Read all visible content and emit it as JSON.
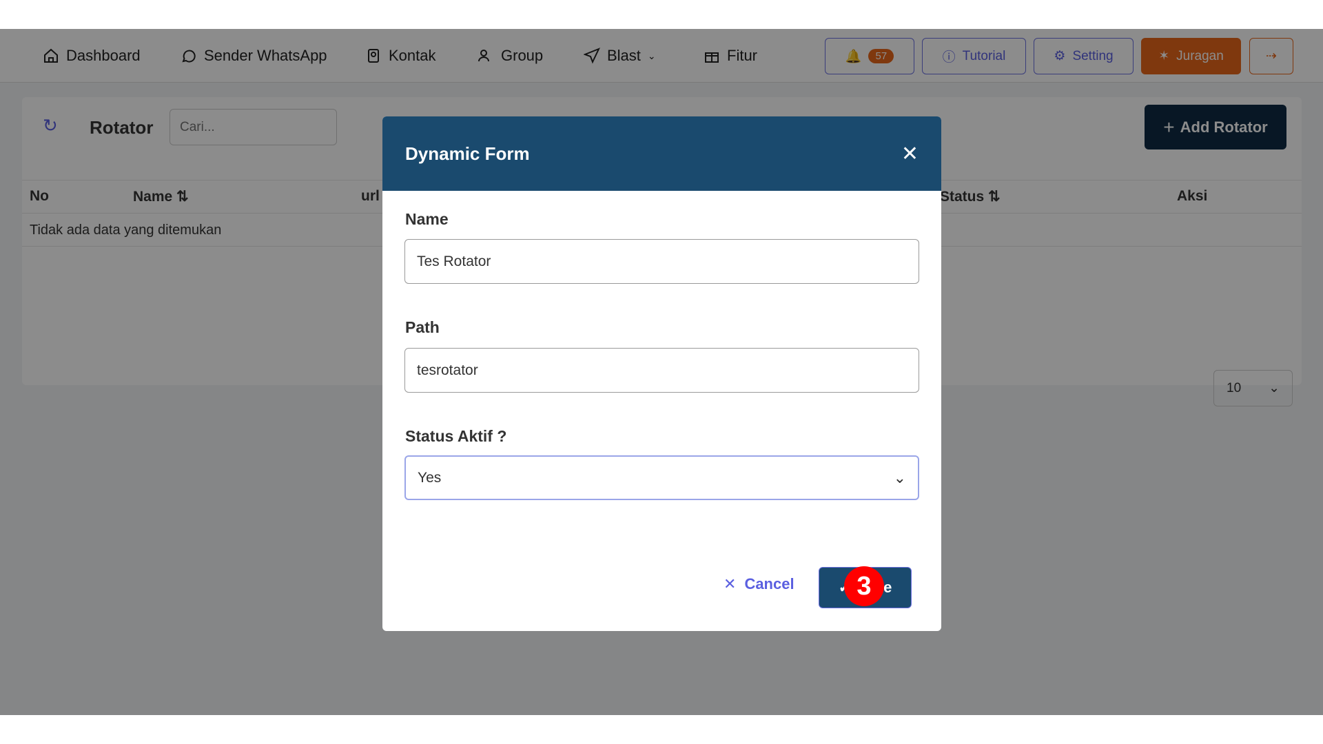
{
  "nav": {
    "items": [
      {
        "label": "Dashboard",
        "icon": "home-icon"
      },
      {
        "label": "Sender WhatsApp",
        "icon": "whatsapp-icon"
      },
      {
        "label": "Kontak",
        "icon": "contact-icon"
      },
      {
        "label": "Group",
        "icon": "users-icon"
      },
      {
        "label": "Blast",
        "icon": "send-icon"
      },
      {
        "label": "Fitur",
        "icon": "gift-icon"
      }
    ],
    "notif_count": "57",
    "tutorial": "Tutorial",
    "setting": "Setting",
    "juragan": "Juragan"
  },
  "page": {
    "title": "Rotator",
    "search_placeholder": "Cari...",
    "add_button": "Add Rotator",
    "columns": [
      "No",
      "Name",
      "url",
      "Status",
      "Aksi"
    ],
    "empty": "Tidak ada data yang ditemukan",
    "page_size": "10"
  },
  "modal": {
    "title": "Dynamic Form",
    "name_label": "Name",
    "name_value": "Tes Rotator",
    "path_label": "Path",
    "path_value": "tesrotator",
    "status_label": "Status Aktif ?",
    "status_value": "Yes",
    "cancel": "Cancel",
    "save": "Save",
    "step_badge": "3"
  },
  "colors": {
    "modal_header": "#1a4a6e",
    "accent": "#5a5fe0",
    "orange": "#e8661a",
    "badge": "#ff0000"
  }
}
